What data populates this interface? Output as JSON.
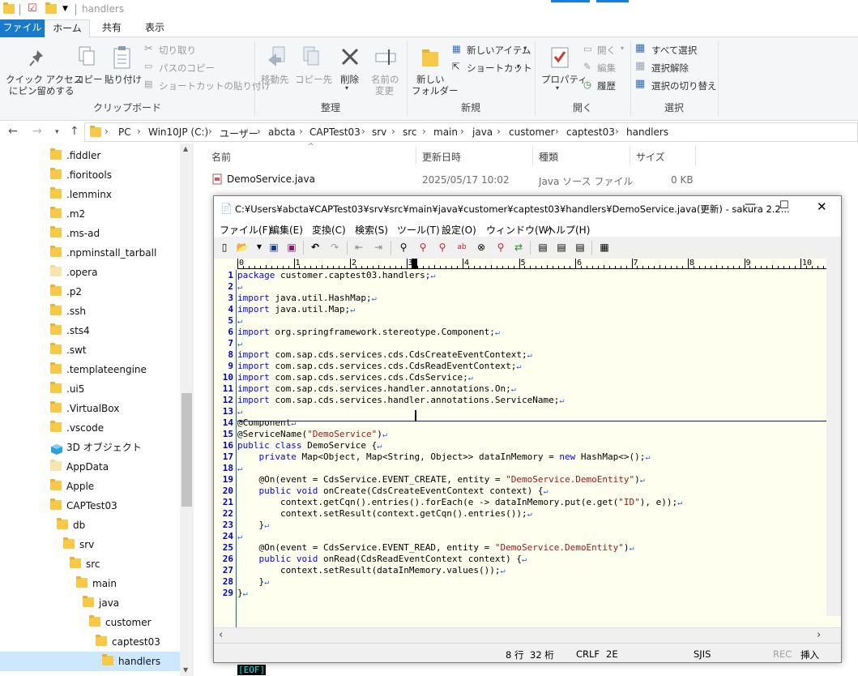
{
  "explorer": {
    "titlebar": {
      "title": "handlers"
    },
    "ribbon_tabs": [
      "ファイル",
      "ホーム",
      "共有",
      "表示"
    ],
    "ribbon": {
      "clipboard": {
        "pin_label_1": "クイック アクセス",
        "pin_label_2": "にピン留めする",
        "copy": "コピー",
        "paste": "貼り付け",
        "cut": "切り取り",
        "copy_path": "パスのコピー",
        "paste_shortcut": "ショートカットの貼り付け",
        "group": "クリップボード"
      },
      "organize": {
        "move_to": "移動先",
        "copy_to": "コピー先",
        "delete": "削除",
        "rename_1": "名前の",
        "rename_2": "変更",
        "group": "整理"
      },
      "new": {
        "new_folder_1": "新しい",
        "new_folder_2": "フォルダー",
        "new_item": "新しいアイテム",
        "shortcut": "ショートカット",
        "group": "新規"
      },
      "open": {
        "properties": "プロパティ",
        "open": "開く",
        "edit": "編集",
        "history": "履歴",
        "group": "開く"
      },
      "select": {
        "select_all": "すべて選択",
        "select_none": "選択解除",
        "invert": "選択の切り替え",
        "group": "選択"
      }
    },
    "breadcrumb": [
      "PC",
      "Win10JP (C:)",
      "ユーザー",
      "abcta",
      "CAPTest03",
      "srv",
      "src",
      "main",
      "java",
      "customer",
      "captest03",
      "handlers"
    ],
    "nav_items": [
      {
        "label": ".fiddler",
        "pale": false
      },
      {
        "label": ".fioritools",
        "pale": false
      },
      {
        "label": ".lemminx",
        "pale": false
      },
      {
        "label": ".m2",
        "pale": false
      },
      {
        "label": ".ms-ad",
        "pale": false
      },
      {
        "label": ".npminstall_tarball",
        "pale": false
      },
      {
        "label": ".opera",
        "pale": true
      },
      {
        "label": ".p2",
        "pale": false
      },
      {
        "label": ".ssh",
        "pale": false
      },
      {
        "label": ".sts4",
        "pale": false
      },
      {
        "label": ".swt",
        "pale": false
      },
      {
        "label": ".templateengine",
        "pale": false
      },
      {
        "label": ".ui5",
        "pale": false
      },
      {
        "label": ".VirtualBox",
        "pale": false
      },
      {
        "label": ".vscode",
        "pale": false
      },
      {
        "label": "3D オブジェクト",
        "pale": false
      },
      {
        "label": "AppData",
        "pale": true
      },
      {
        "label": "Apple",
        "pale": false
      },
      {
        "label": "CAPTest03",
        "pale": false
      },
      {
        "label": "db",
        "pale": false
      },
      {
        "label": "srv",
        "pale": false
      },
      {
        "label": "src",
        "pale": false
      },
      {
        "label": "main",
        "pale": false
      },
      {
        "label": "java",
        "pale": false
      },
      {
        "label": "customer",
        "pale": false
      },
      {
        "label": "captest03",
        "pale": false
      },
      {
        "label": "handlers",
        "pale": false
      }
    ],
    "list": {
      "columns": [
        "名前",
        "更新日時",
        "種類",
        "サイズ"
      ],
      "rows": [
        {
          "name": "DemoService.java",
          "modified": "2025/05/17 10:02",
          "type": "Java ソース ファイル",
          "size": "0 KB"
        }
      ]
    }
  },
  "sakura": {
    "title": "C:¥Users¥abcta¥CAPTest03¥srv¥src¥main¥java¥customer¥captest03¥handlers¥DemoService.java(更新) - sakura 2.2...",
    "menu": [
      "ファイル(F)",
      "編集(E)",
      "変換(C)",
      "検索(S)",
      "ツール(T)",
      "設定(O)",
      "ウィンドウ(W)",
      "ヘルプ(H)"
    ],
    "ruler_numbers": [
      "0",
      "1",
      "2",
      "3",
      "4",
      "5",
      "6",
      "7",
      "8",
      "9",
      "10"
    ],
    "code_lines": [
      "package customer.captest03.handlers;",
      "",
      "import java.util.HashMap;",
      "import java.util.Map;",
      "",
      "import org.springframework.stereotype.Component;",
      "",
      "import com.sap.cds.services.cds.CdsCreateEventContext;",
      "import com.sap.cds.services.cds.CdsReadEventContext;",
      "import com.sap.cds.services.cds.CdsService;",
      "import com.sap.cds.services.handler.annotations.On;",
      "import com.sap.cds.services.handler.annotations.ServiceName;",
      "",
      "@Component",
      "@ServiceName(\"DemoService\")",
      "public class DemoService {",
      "    private Map<Object, Map<String, Object>> dataInMemory = new HashMap<>();",
      "",
      "    @On(event = CdsService.EVENT_CREATE, entity = \"DemoService.DemoEntity\")",
      "    public void onCreate(CdsCreateEventContext context) {",
      "        context.getCqn().entries().forEach(e -> dataInMemory.put(e.get(\"ID\"), e));",
      "        context.setResult(context.getCqn().entries());",
      "    }",
      "",
      "    @On(event = CdsService.EVENT_READ, entity = \"DemoService.DemoEntity\")",
      "    public void onRead(CdsReadEventContext context) {",
      "        context.setResult(dataInMemory.values());",
      "    }",
      "}"
    ],
    "eof": "[EOF]",
    "status": {
      "line": "8 行",
      "col": "32 桁",
      "newline": "CRLF",
      "charcode": "2E",
      "encoding": "SJIS",
      "rec": "REC",
      "insert": "挿入"
    }
  }
}
